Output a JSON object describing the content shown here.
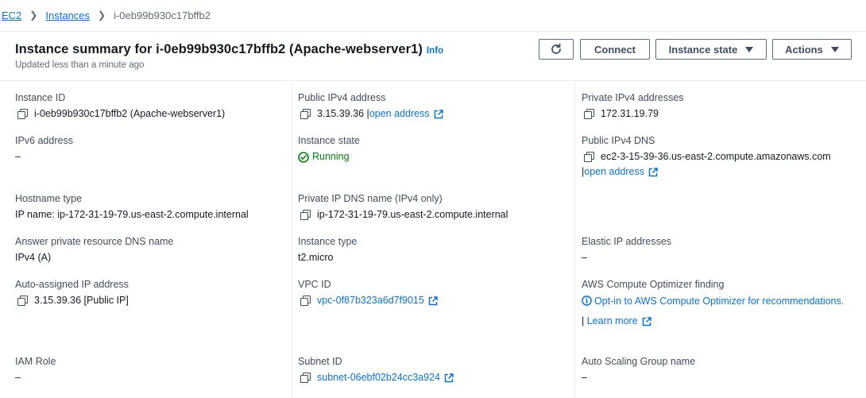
{
  "breadcrumb": {
    "root": "EC2",
    "instances": "Instances",
    "current": "i-0eb99b930c17bffb2"
  },
  "header": {
    "title": "Instance summary for i-0eb99b930c17bffb2 (Apache-webserver1)",
    "info": "Info",
    "updated": "Updated less than a minute ago",
    "connect": "Connect",
    "instance_state": "Instance state",
    "actions": "Actions"
  },
  "fields": {
    "instance_id": {
      "label": "Instance ID",
      "value": "i-0eb99b930c17bffb2 (Apache-webserver1)"
    },
    "public_ipv4": {
      "label": "Public IPv4 address",
      "value": "3.15.39.36 |",
      "link": "open address"
    },
    "private_ipv4": {
      "label": "Private IPv4 addresses",
      "value": "172.31.19.79"
    },
    "ipv6": {
      "label": "IPv6 address",
      "value": "–"
    },
    "instance_state": {
      "label": "Instance state",
      "value": "Running",
      "color": "#037f0c"
    },
    "public_dns": {
      "label": "Public IPv4 DNS",
      "value": "ec2-3-15-39-36.us-east-2.compute.amazonaws.com",
      "link": "open address"
    },
    "hostname_type": {
      "label": "Hostname type",
      "value": "IP name: ip-172-31-19-79.us-east-2.compute.internal"
    },
    "private_dns": {
      "label": "Private IP DNS name (IPv4 only)",
      "value": "ip-172-31-19-79.us-east-2.compute.internal"
    },
    "answer_dns": {
      "label": "Answer private resource DNS name",
      "value": "IPv4 (A)"
    },
    "instance_type": {
      "label": "Instance type",
      "value": "t2.micro"
    },
    "elastic_ip": {
      "label": "Elastic IP addresses",
      "value": "–"
    },
    "auto_ip": {
      "label": "Auto-assigned IP address",
      "value": "3.15.39.36 [Public IP]"
    },
    "vpc": {
      "label": "VPC ID",
      "value": "vpc-0f87b323a6d7f9015"
    },
    "optimizer": {
      "label": "AWS Compute Optimizer finding",
      "link": "Opt-in to AWS Compute Optimizer for recommendations.",
      "learn": "Learn more"
    },
    "iam": {
      "label": "IAM Role",
      "value": "–"
    },
    "subnet": {
      "label": "Subnet ID",
      "value": "subnet-06ebf02b24cc3a924"
    },
    "asg": {
      "label": "Auto Scaling Group name",
      "value": "–"
    }
  },
  "colors": {
    "link": "#0972d3",
    "success": "#037f0c",
    "text": "#16191f",
    "label": "#414d5c"
  },
  "icons": [
    "refresh-icon",
    "caret-down-icon",
    "copy-icon",
    "external-link-icon",
    "check-circle-icon",
    "info-circle-icon"
  ]
}
